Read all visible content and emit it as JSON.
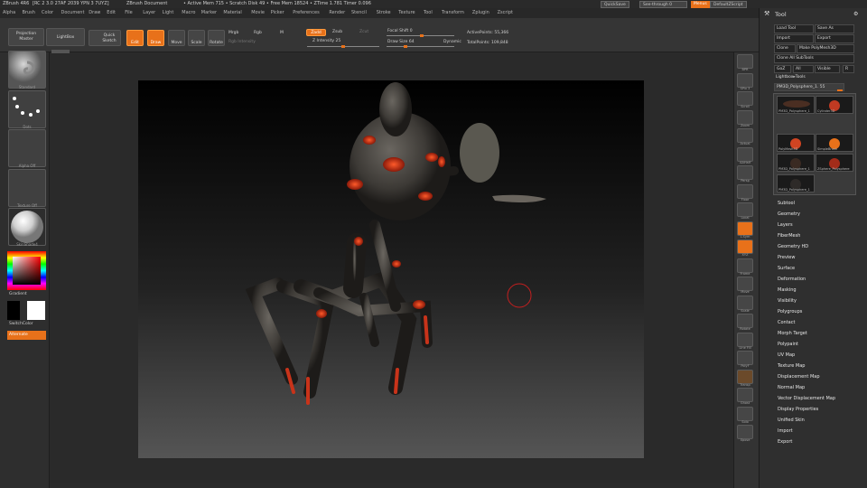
{
  "title_bar": {
    "app": "ZBrush 4R6",
    "memory": "[RC 2 3.0 27AF 2039 YPN 3 7UYZ]",
    "doc": "ZBrush Document",
    "stats": "• Active Mem 715 • Scratch Disk 49 • Free Mem 18524 • ZTime 1.781 Timer 0.096"
  },
  "top_right": {
    "quicksave": "QuickSave",
    "seethrough": "See-through  0",
    "menus": "Menus",
    "script": "DefaultZScript"
  },
  "menus": [
    "Alpha",
    "Brush",
    "Color",
    "Document",
    "Draw",
    "Edit",
    "File",
    "Layer",
    "Light",
    "Macro",
    "Marker",
    "Material",
    "Movie",
    "Picker",
    "Preferences",
    "Render",
    "Stencil",
    "Stroke",
    "Texture",
    "Tool",
    "Transform",
    "Zplugin",
    "Zscript"
  ],
  "toolbar": {
    "projection_master": "Projection Master",
    "lightbox": "LightBox",
    "quick_sketch": "Quick Sketch",
    "edit": "Edit",
    "draw": "Draw",
    "move": "Move",
    "scale": "Scale",
    "rotate": "Rotate",
    "mrgb": "Mrgb",
    "rgb": "Rgb",
    "m": "M",
    "rgb_intensity": "Rgb Intensity",
    "zadd": "Zadd",
    "zsub": "Zsub",
    "zcut": "Zcut",
    "z_intensity": "Z Intensity 25",
    "focal_shift": "Focal Shift 0",
    "draw_size": "Draw Size 64",
    "dynamic": "Dynamic",
    "active_points": "ActivePoints: 55,366",
    "total_points": "TotalPoints: 109,848"
  },
  "left_tray": {
    "brush_label": "Standard",
    "stroke_label": "Dots",
    "alpha_label": "Alpha Off",
    "texture_label": "Texture Off",
    "material_label": "SkinShade4",
    "gradient_label": "Gradient",
    "switch_color_label": "SwitchColor",
    "alternate_label": "Alternate"
  },
  "right_shelf": [
    {
      "label": "BPR",
      "icon": "bpr-icon"
    },
    {
      "label": "SPix 3",
      "icon": "spix-icon"
    },
    {
      "label": "Scroll",
      "icon": "scroll-icon"
    },
    {
      "label": "Zoom",
      "icon": "zoom-icon"
    },
    {
      "label": "Actual",
      "icon": "actual-icon"
    },
    {
      "label": "AAHalf",
      "icon": "aahalf-icon"
    },
    {
      "label": "Persp",
      "icon": "persp-icon"
    },
    {
      "label": "Floor",
      "icon": "floor-icon"
    },
    {
      "label": "Local",
      "icon": "local-icon"
    },
    {
      "label": "L.Sym",
      "icon": "lsym-icon"
    },
    {
      "label": "XYZ",
      "icon": "xyz-icon"
    },
    {
      "label": "Frame",
      "icon": "frame-icon"
    },
    {
      "label": "Move",
      "icon": "move-icon"
    },
    {
      "label": "Scale",
      "icon": "scale-icon"
    },
    {
      "label": "Rotate",
      "icon": "rotate-icon"
    },
    {
      "label": "Line Fill",
      "icon": "linefill-icon"
    },
    {
      "label": "PolyF",
      "icon": "polyf-icon"
    },
    {
      "label": "Transp",
      "icon": "transp-icon"
    },
    {
      "label": "Ghost",
      "icon": "ghost-icon"
    },
    {
      "label": "Solo",
      "icon": "solo-icon"
    },
    {
      "label": "Xpose",
      "icon": "xpose-icon"
    }
  ],
  "tool_panel": {
    "title": "Tool",
    "buttons": [
      "Load Tool",
      "Save As",
      "Import",
      "Export",
      "Clone",
      "Make PolyMesh3D",
      "Clone All SubTools"
    ],
    "goz": "GoZ",
    "all": "All",
    "visible": "Visible",
    "r": "R",
    "lightbox_tools": "Lightbox▸Tools",
    "current_tool": "PM3D_Polysphere_1. 55",
    "thumbs": [
      {
        "label": "PM3D_Polysphere_1"
      },
      {
        "label": "Cylinder3D"
      },
      {
        "label": "PolyMesh3D"
      },
      {
        "label": "SimpleBrush"
      },
      {
        "label": "ZSphere_Polysphere"
      },
      {
        "label": "PM3D_Polysphere_1"
      },
      {
        "label": "PM3D_Polysphere_1"
      }
    ],
    "subpalettes": [
      "Subtool",
      "Geometry",
      "Layers",
      "FiberMesh",
      "Geometry HD",
      "Preview",
      "Surface",
      "Deformation",
      "Masking",
      "Visibility",
      "Polygroups",
      "Contact",
      "Morph Target",
      "Polypaint",
      "UV Map",
      "Texture Map",
      "Displacement Map",
      "Normal Map",
      "Vector Displacement Map",
      "Display Properties",
      "Unified Skin",
      "Import",
      "Export"
    ]
  },
  "colors": {
    "accent": "#e8711a",
    "panel": "#2f2f2f",
    "canvas_top": "#000000",
    "canvas_bottom": "#555555"
  }
}
